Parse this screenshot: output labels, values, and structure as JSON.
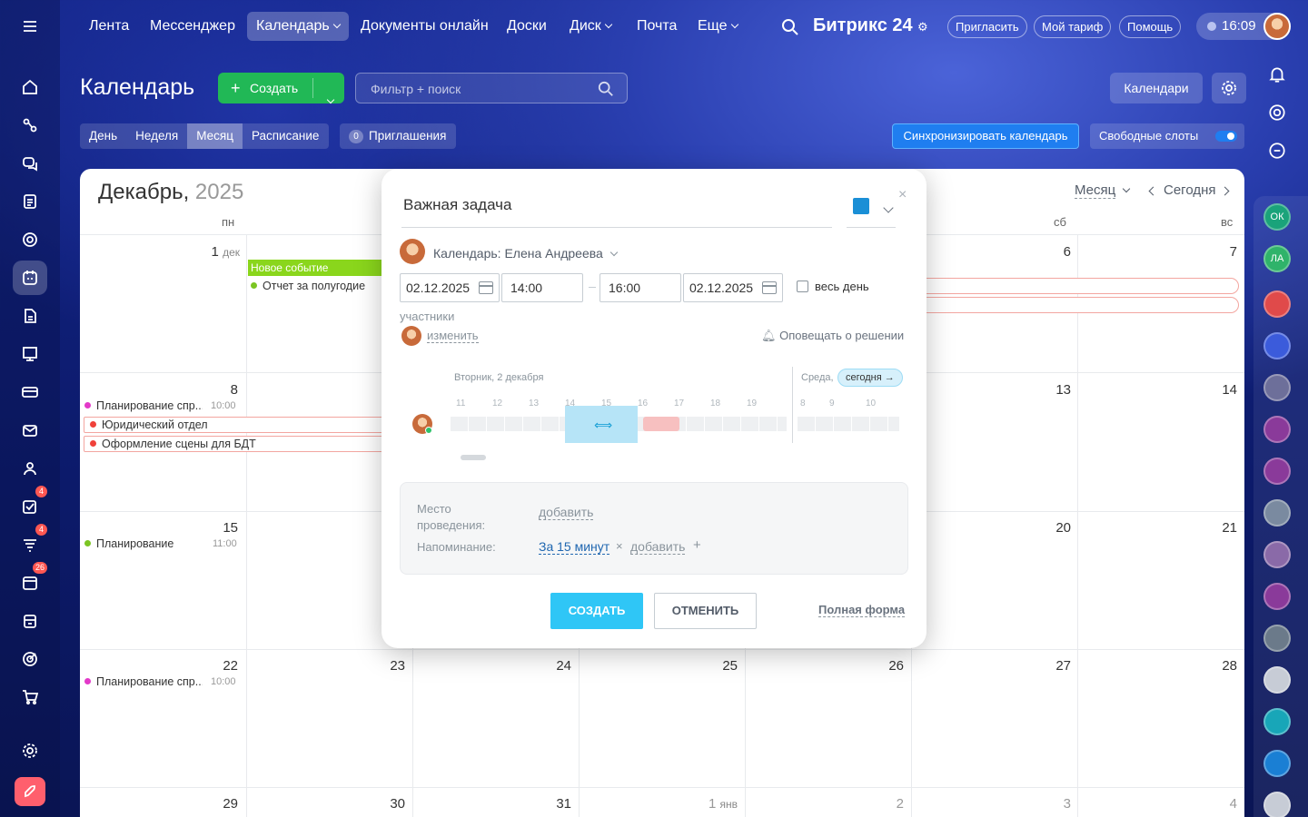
{
  "nav": {
    "items": [
      {
        "label": "Лента"
      },
      {
        "label": "Мессенджер"
      },
      {
        "label": "Календарь"
      },
      {
        "label": "Документы онлайн"
      },
      {
        "label": "Доски"
      },
      {
        "label": "Диск"
      },
      {
        "label": "Почта"
      },
      {
        "label": "Еще"
      }
    ],
    "brand": "Битрикс 24",
    "invite": "Пригласить",
    "tariff": "Мой тариф",
    "help": "Помощь",
    "time": "16:09"
  },
  "sidebar": {
    "badges": {
      "tasks": "4",
      "feed": "4",
      "calendar": "26"
    }
  },
  "toolbar": {
    "title": "Календарь",
    "create": "Создать",
    "search_placeholder": "Фильтр + поиск",
    "calendars": "Календари",
    "views": [
      "День",
      "Неделя",
      "Месяц",
      "Расписание"
    ],
    "active_view": "Месяц",
    "invites_count": "0",
    "invites": "Приглашения",
    "sync": "Синхронизировать календарь",
    "free_slots": "Свободные слоты"
  },
  "calendar": {
    "month": "Декабрь,",
    "year": "2025",
    "view_select": "Месяц",
    "today": "Сегодня",
    "weekdays": {
      "mon": "пн",
      "sat": "сб",
      "sun": "вс"
    },
    "days": {
      "d1": "1",
      "d1m": "дек",
      "d6": "6",
      "d7": "7",
      "d8": "8",
      "d13": "13",
      "d14": "14",
      "d15": "15",
      "d20": "20",
      "d21": "21",
      "d22": "22",
      "d23": "23",
      "d24": "24",
      "d25": "25",
      "d26": "26",
      "d27": "27",
      "d28": "28",
      "d29": "29",
      "d30": "30",
      "d31": "31",
      "j1": "1",
      "j1m": "янв",
      "j2": "2",
      "j3": "3",
      "j4": "4"
    },
    "events": {
      "new_event": "Новое событие",
      "report": "Отчет за полугодие",
      "plan1": "Планирование спр...",
      "plan1_time": "10:00",
      "legal": "Юридический отдел",
      "scene": "Оформление сцены для БДТ",
      "plan2": "Планирование",
      "plan2_time": "11:00",
      "plan3": "Планирование спр...",
      "plan3_time": "10:00"
    }
  },
  "modal": {
    "title": "Важная задача",
    "color": "#1a8fd6",
    "calendar_label": "Календарь: Елена Андреева",
    "date_from": "02.12.2025",
    "time_from": "14:00",
    "time_to": "16:00",
    "date_to": "02.12.2025",
    "allday": "весь день",
    "participants": "участники",
    "change": "изменить",
    "notify": "Оповещать о решении",
    "timeline": {
      "day1": "Вторник, 2 декабря",
      "day2": "Среда,",
      "today_pill": "сегодня",
      "hours1": [
        "11",
        "12",
        "13",
        "14",
        "15",
        "16",
        "17",
        "18",
        "19"
      ],
      "hours2": [
        "8",
        "9",
        "10"
      ]
    },
    "location_label": "Место проведения:",
    "location_add": "добавить",
    "reminder_label": "Напоминание:",
    "reminder_value": "За 15 минут",
    "reminder_add": "добавить",
    "create": "СОЗДАТЬ",
    "cancel": "ОТМЕНИТЬ",
    "full_form": "Полная форма"
  },
  "rsb": {
    "ok": "ОК",
    "la": "ЛА"
  }
}
